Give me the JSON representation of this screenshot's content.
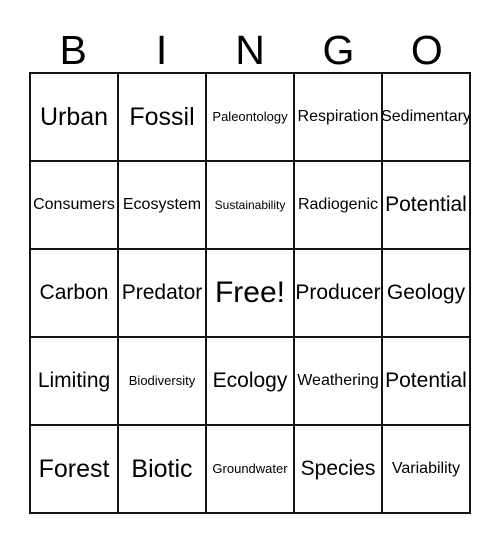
{
  "card": {
    "headers": [
      "B",
      "I",
      "N",
      "G",
      "O"
    ],
    "rows": [
      [
        {
          "text": "Urban",
          "size": "lg"
        },
        {
          "text": "Fossil",
          "size": "lg"
        },
        {
          "text": "Paleontology",
          "size": "xs"
        },
        {
          "text": "Respiration",
          "size": "sm"
        },
        {
          "text": "Sedimentary",
          "size": "sm"
        }
      ],
      [
        {
          "text": "Consumers",
          "size": "sm"
        },
        {
          "text": "Ecosystem",
          "size": "sm"
        },
        {
          "text": "Sustainability",
          "size": "xxs"
        },
        {
          "text": "Radiogenic",
          "size": "sm"
        },
        {
          "text": "Potential",
          "size": "md"
        }
      ],
      [
        {
          "text": "Carbon",
          "size": "md"
        },
        {
          "text": "Predator",
          "size": "md"
        },
        {
          "text": "Free!",
          "size": "xl"
        },
        {
          "text": "Producer",
          "size": "md"
        },
        {
          "text": "Geology",
          "size": "md"
        }
      ],
      [
        {
          "text": "Limiting",
          "size": "md"
        },
        {
          "text": "Biodiversity",
          "size": "xs"
        },
        {
          "text": "Ecology",
          "size": "md"
        },
        {
          "text": "Weathering",
          "size": "sm"
        },
        {
          "text": "Potential",
          "size": "md"
        }
      ],
      [
        {
          "text": "Forest",
          "size": "lg"
        },
        {
          "text": "Biotic",
          "size": "lg"
        },
        {
          "text": "Groundwater",
          "size": "xs"
        },
        {
          "text": "Species",
          "size": "md"
        },
        {
          "text": "Variability",
          "size": "sm"
        }
      ]
    ],
    "free_space": {
      "row": 2,
      "col": 2,
      "text": "Free!"
    },
    "colors": {
      "background": "#ffffff",
      "text": "#000000",
      "grid_line": "#141414"
    }
  }
}
